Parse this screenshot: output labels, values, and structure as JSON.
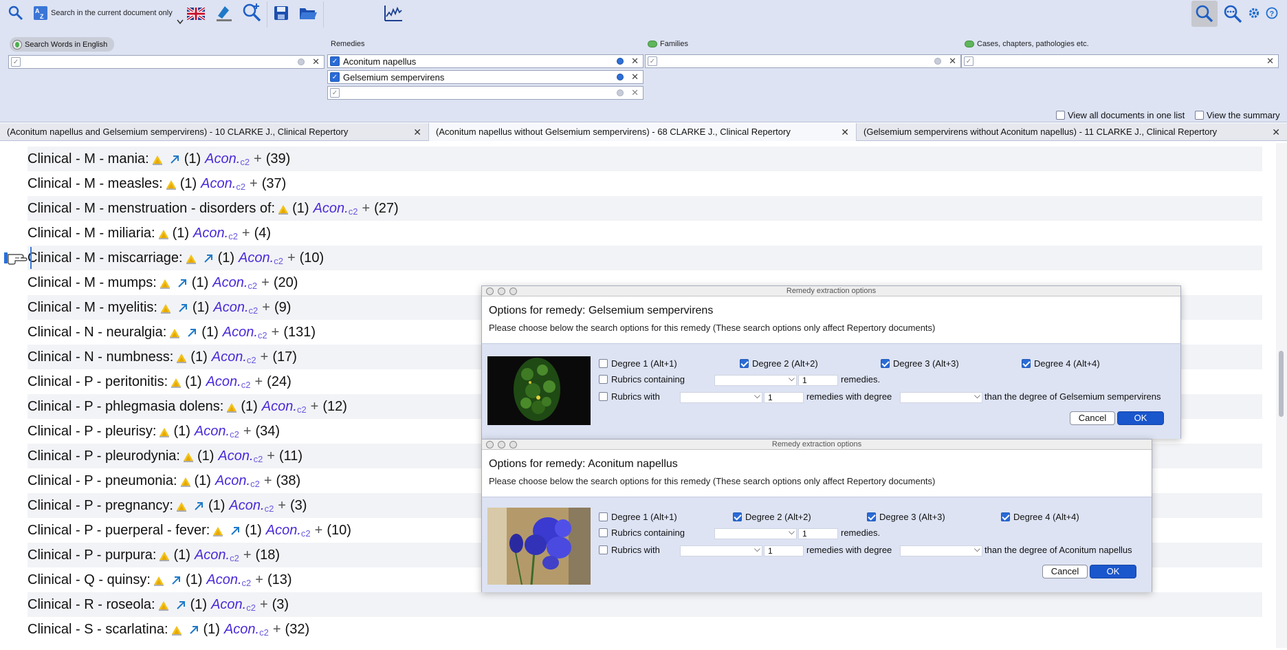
{
  "toolbar": {
    "search_scope_label": "Search in the current document only",
    "icons": [
      "search-icon",
      "az-sort-icon",
      "uk-flag-icon",
      "highlight-tool-icon",
      "zoom-add-icon",
      "save-icon",
      "open-folder-icon",
      "chart-icon",
      "search-view-icon",
      "zoom-more-icon",
      "gear-icon",
      "help-icon"
    ]
  },
  "search": {
    "words_button": "Search Words in English",
    "remedies_label": "Remedies",
    "families_label": "Families",
    "cases_label": "Cases, chapters, pathologies etc.",
    "remedy_1": "Aconitum napellus",
    "remedy_2": "Gelsemium sempervirens",
    "view_all_label": "View all documents in one list",
    "view_summary_label": "View the summary"
  },
  "tabs": [
    {
      "label": "(Aconitum napellus and Gelsemium sempervirens) - 10 CLARKE J., Clinical Repertory"
    },
    {
      "label": "(Aconitum napellus without Gelsemium sempervirens) - 68 CLARKE J., Clinical Repertory"
    },
    {
      "label": "(Gelsemium sempervirens without Aconitum napellus) - 11 CLARKE J., Clinical Repertory"
    }
  ],
  "rubrics": [
    {
      "text": "Clinical - M - mania:",
      "count": "(1)",
      "remedy": "Acon.",
      "degree": "c2",
      "plus": "+",
      "total": "(39)"
    },
    {
      "text": "Clinical - M - measles:",
      "count": "(1)",
      "remedy": "Acon.",
      "degree": "c2",
      "plus": "+",
      "total": "(37)"
    },
    {
      "text": "Clinical - M - menstruation - disorders of:",
      "count": "(1)",
      "remedy": "Acon.",
      "degree": "c2",
      "plus": "+",
      "total": "(27)"
    },
    {
      "text": "Clinical - M - miliaria:",
      "count": "(1)",
      "remedy": "Acon.",
      "degree": "c2",
      "plus": "+",
      "total": "(4)"
    },
    {
      "text": "Clinical - M - miscarriage:",
      "count": "(1)",
      "remedy": "Acon.",
      "degree": "c2",
      "plus": "+",
      "total": "(10)"
    },
    {
      "text": "Clinical - M - mumps:",
      "count": "(1)",
      "remedy": "Acon.",
      "degree": "c2",
      "plus": "+",
      "total": "(20)"
    },
    {
      "text": "Clinical - M - myelitis:",
      "count": "(1)",
      "remedy": "Acon.",
      "degree": "c2",
      "plus": "+",
      "total": "(9)"
    },
    {
      "text": "Clinical - N - neuralgia:",
      "count": "(1)",
      "remedy": "Acon.",
      "degree": "c2",
      "plus": "+",
      "total": "(131)"
    },
    {
      "text": "Clinical - N - numbness:",
      "count": "(1)",
      "remedy": "Acon.",
      "degree": "c2",
      "plus": "+",
      "total": "(17)"
    },
    {
      "text": "Clinical - P - peritonitis:",
      "count": "(1)",
      "remedy": "Acon.",
      "degree": "c2",
      "plus": "+",
      "total": "(24)"
    },
    {
      "text": "Clinical - P - phlegmasia dolens:",
      "count": "(1)",
      "remedy": "Acon.",
      "degree": "c2",
      "plus": "+",
      "total": "(12)"
    },
    {
      "text": "Clinical - P - pleurisy:",
      "count": "(1)",
      "remedy": "Acon.",
      "degree": "c2",
      "plus": "+",
      "total": "(34)"
    },
    {
      "text": "Clinical - P - pleurodynia:",
      "count": "(1)",
      "remedy": "Acon.",
      "degree": "c2",
      "plus": "+",
      "total": "(11)"
    },
    {
      "text": "Clinical - P - pneumonia:",
      "count": "(1)",
      "remedy": "Acon.",
      "degree": "c2",
      "plus": "+",
      "total": "(38)"
    },
    {
      "text": "Clinical - P - pregnancy:",
      "count": "(1)",
      "remedy": "Acon.",
      "degree": "c2",
      "plus": "+",
      "total": "(3)"
    },
    {
      "text": "Clinical - P - puerperal - fever:",
      "count": "(1)",
      "remedy": "Acon.",
      "degree": "c2",
      "plus": "+",
      "total": "(10)"
    },
    {
      "text": "Clinical - P - purpura:",
      "count": "(1)",
      "remedy": "Acon.",
      "degree": "c2",
      "plus": "+",
      "total": "(18)"
    },
    {
      "text": "Clinical - Q - quinsy:",
      "count": "(1)",
      "remedy": "Acon.",
      "degree": "c2",
      "plus": "+",
      "total": "(13)"
    },
    {
      "text": "Clinical - R - roseola:",
      "count": "(1)",
      "remedy": "Acon.",
      "degree": "c2",
      "plus": "+",
      "total": "(3)"
    },
    {
      "text": "Clinical - S - scarlatina:",
      "count": "(1)",
      "remedy": "Acon.",
      "degree": "c2",
      "plus": "+",
      "total": "(32)"
    }
  ],
  "dialog_gels": {
    "window_title": "Remedy extraction options",
    "heading": "Options for remedy: Gelsemium sempervirens",
    "subtitle": "Please choose below the search options for this remedy (These search options only affect Repertory documents)",
    "degree1": "Degree 1 (Alt+1)",
    "degree2": "Degree 2 (Alt+2)",
    "degree3": "Degree 3 (Alt+3)",
    "degree4": "Degree 4 (Alt+4)",
    "rubrics_containing": "Rubrics containing",
    "remedies_suffix": "remedies.",
    "rubrics_with": "Rubrics with",
    "remedies_with_degree": "remedies with degree",
    "than_degree": "than the degree of Gelsemium sempervirens",
    "num1": "1",
    "num2": "1",
    "cancel": "Cancel",
    "ok": "OK"
  },
  "dialog_acon": {
    "window_title": "Remedy extraction options",
    "heading": "Options for remedy: Aconitum napellus",
    "subtitle": "Please choose below the search options for this remedy (These search options only affect Repertory documents)",
    "degree1": "Degree 1 (Alt+1)",
    "degree2": "Degree 2 (Alt+2)",
    "degree3": "Degree 3 (Alt+3)",
    "degree4": "Degree 4 (Alt+4)",
    "rubrics_containing": "Rubrics containing",
    "remedies_suffix": "remedies.",
    "rubrics_with": "Rubrics with",
    "remedies_with_degree": "remedies with degree",
    "than_degree": "than the degree of Aconitum napellus",
    "num1": "1",
    "num2": "1",
    "cancel": "Cancel",
    "ok": "OK"
  },
  "colors": {
    "toolbar_bg": "#dde3f3",
    "remedy_text": "#4a2ad8",
    "accent_blue": "#1a56cc"
  }
}
